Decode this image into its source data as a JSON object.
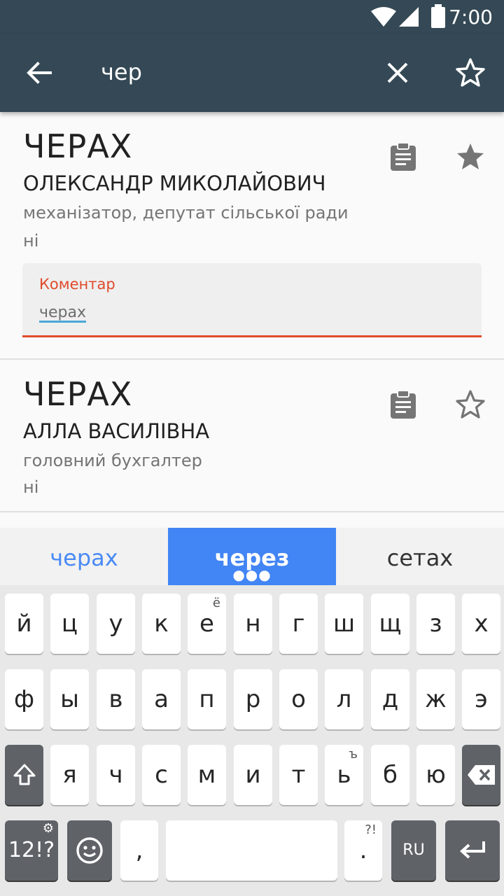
{
  "status": {
    "time": "7:00"
  },
  "search": {
    "query": "чер"
  },
  "results": [
    {
      "surname": "ЧЕРАХ",
      "name": "ОЛЕКСАНДР МИКОЛАЙОВИЧ",
      "position": "механізатор, депутат сільської ради",
      "party": "ні",
      "favorite": true,
      "comment_label": "Коментар",
      "comment_value": "черах"
    },
    {
      "surname": "ЧЕРАХ",
      "name": "АЛЛА ВАСИЛІВНА",
      "position": "головний бухгалтер",
      "party": "ні",
      "favorite": false
    }
  ],
  "suggestions": [
    "черах",
    "через",
    "сетах"
  ],
  "keyboard": {
    "row1": [
      "й",
      "ц",
      "у",
      "к",
      "е",
      "н",
      "г",
      "ш",
      "щ",
      "з",
      "х"
    ],
    "row1_hint_e": "ё",
    "row2": [
      "ф",
      "ы",
      "в",
      "а",
      "п",
      "р",
      "о",
      "л",
      "д",
      "ж",
      "э"
    ],
    "row3": [
      "я",
      "ч",
      "с",
      "м",
      "и",
      "т",
      "ь",
      "б",
      "ю"
    ],
    "row3_hint_soft": "ъ",
    "symbols_label": "12!?",
    "comma": ",",
    "period": ".",
    "period_hint": "?!",
    "lang": "RU"
  },
  "colors": {
    "appbar": "#344955",
    "accent": "#e04a2b",
    "suggest_highlight": "#4285f4"
  }
}
